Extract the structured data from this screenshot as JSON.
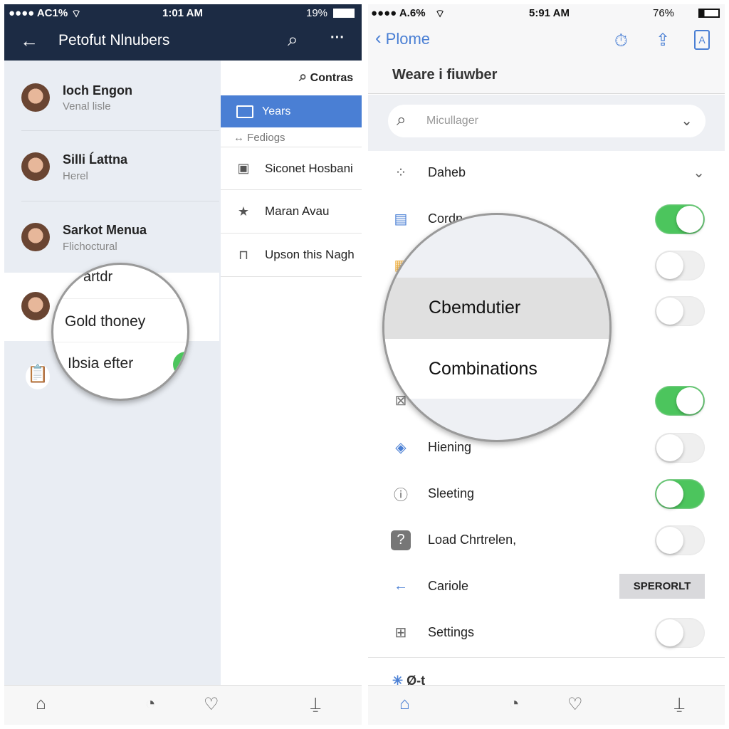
{
  "left": {
    "status": {
      "carrier": "●●●● AC1%",
      "time": "1:01 AM",
      "battery": "19%"
    },
    "header": {
      "title": "Petofut Nlnubers",
      "back_icon": "arrow-left-icon",
      "search_icon": "search-icon",
      "more_icon": "more-icon"
    },
    "contacts": [
      {
        "name": "Ioch Engon",
        "sub": "Venal lisle"
      },
      {
        "name": "Silli Ĺattna",
        "sub": "Herel"
      },
      {
        "name": "Sarkot Menua",
        "sub": "Flichoctural"
      }
    ],
    "panel": {
      "search_label": "Contras",
      "selected": "Years",
      "subheader": "Fediogs",
      "items": [
        {
          "icon": "calendar-icon",
          "label": "Siconet Hosbani"
        },
        {
          "icon": "star-icon",
          "label": "Maran Avau"
        },
        {
          "icon": "bag-icon",
          "label": "Upson this Nagh"
        }
      ]
    },
    "magnifier": {
      "items": [
        "artdr",
        "Gold thoney",
        "Ibsia efter"
      ]
    },
    "tabs": [
      "home-icon",
      "clock-icon",
      "heart-icon",
      "share-icon"
    ]
  },
  "right": {
    "status": {
      "carrier": "●●●● A.6%",
      "time": "5:91 AM",
      "battery": "76%"
    },
    "nav": {
      "back_label": "Plome",
      "icons": [
        "timer-icon",
        "share-icon",
        "lock-icon"
      ]
    },
    "title": "Weare i fiuwber",
    "search": {
      "placeholder": "Micullager"
    },
    "rows": [
      {
        "label": "Daheb",
        "control": "chevron"
      },
      {
        "label": "Cordn",
        "control": "toggle",
        "on": true
      },
      {
        "label": "",
        "control": "toggle",
        "on": false
      },
      {
        "label": "",
        "control": "toggle",
        "on": false
      },
      {
        "label": "",
        "control": "toggle",
        "on": true
      },
      {
        "label": "Hiening",
        "control": "toggle",
        "on": false
      },
      {
        "label": "Sleeting",
        "control": "toggle",
        "on": true
      },
      {
        "label": "Load Chrtrelen,",
        "control": "toggle",
        "on": false
      },
      {
        "label": "Cariole",
        "control": "button",
        "button_label": "SPERORLT"
      },
      {
        "label": "Settings",
        "control": "toggle",
        "on": false
      }
    ],
    "footer_partial": "Ø-t",
    "magnifier": {
      "items": [
        "Cbemdutier",
        "Combinations"
      ]
    },
    "tabs": [
      "home-icon",
      "clock-icon",
      "heart-icon",
      "share-icon"
    ]
  },
  "colors": {
    "navy": "#1c2b44",
    "accent": "#4a7fd4",
    "toggle_on": "#4cc55d"
  }
}
